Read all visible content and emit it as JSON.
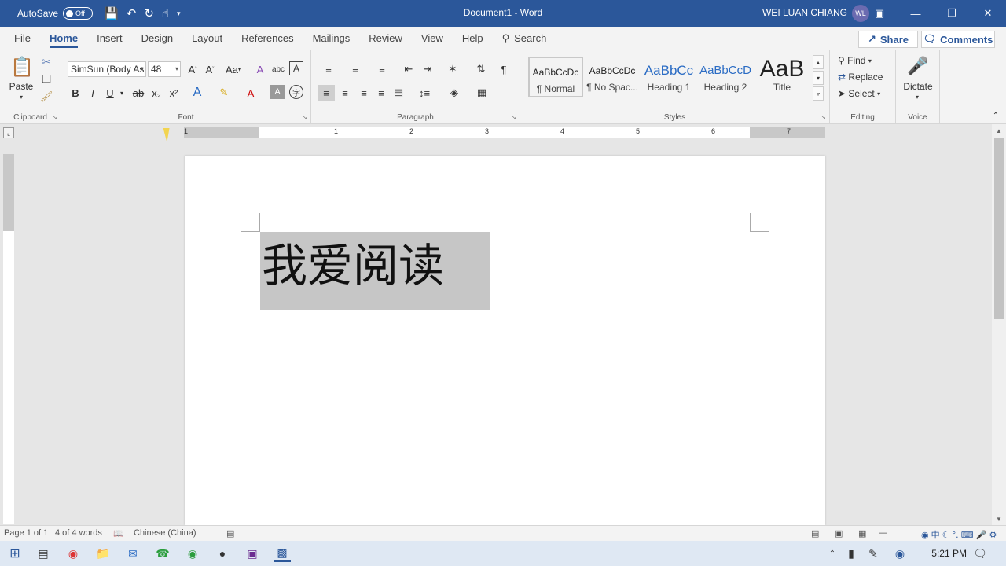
{
  "titlebar": {
    "autosave_label": "AutoSave",
    "autosave_state": "Off",
    "doc_title": "Document1  -  Word",
    "user_name": "WEI LUAN CHIANG",
    "user_initials": "WL"
  },
  "tabs": [
    "File",
    "Home",
    "Insert",
    "Design",
    "Layout",
    "References",
    "Mailings",
    "Review",
    "View",
    "Help"
  ],
  "active_tab": "Home",
  "search_label": "Search",
  "share_label": "Share",
  "comments_label": "Comments",
  "clipboard": {
    "paste_label": "Paste",
    "group_label": "Clipboard"
  },
  "font": {
    "font_name": "SimSun (Body As",
    "font_size": "48",
    "group_label": "Font",
    "bold": "B",
    "italic": "I",
    "underline": "U",
    "strike": "ab",
    "subscript": "x₂",
    "superscript": "x²",
    "case_label": "Aa"
  },
  "paragraph": {
    "group_label": "Paragraph"
  },
  "styles": {
    "group_label": "Styles",
    "items": [
      {
        "preview": "AaBbCcDc",
        "name": "¶ Normal"
      },
      {
        "preview": "AaBbCcDc",
        "name": "¶ No Spac..."
      },
      {
        "preview": "AaBbCc",
        "name": "Heading 1"
      },
      {
        "preview": "AaBbCcD",
        "name": "Heading 2"
      },
      {
        "preview": "AaB",
        "name": "Title"
      }
    ]
  },
  "editing": {
    "find": "Find",
    "replace": "Replace",
    "select": "Select",
    "group_label": "Editing"
  },
  "voice": {
    "dictate": "Dictate",
    "group_label": "Voice"
  },
  "ruler_numbers": [
    "1",
    "1",
    "2",
    "3",
    "4",
    "5",
    "6",
    "7"
  ],
  "document": {
    "text": "我爱阅读"
  },
  "statusbar": {
    "page": "Page 1 of 1",
    "words": "4 of 4 words",
    "language": "Chinese (China)"
  },
  "taskbar": {
    "time": "5:21 PM"
  },
  "colors": {
    "accent": "#2b579a",
    "highlight": "#c6c6c6"
  }
}
